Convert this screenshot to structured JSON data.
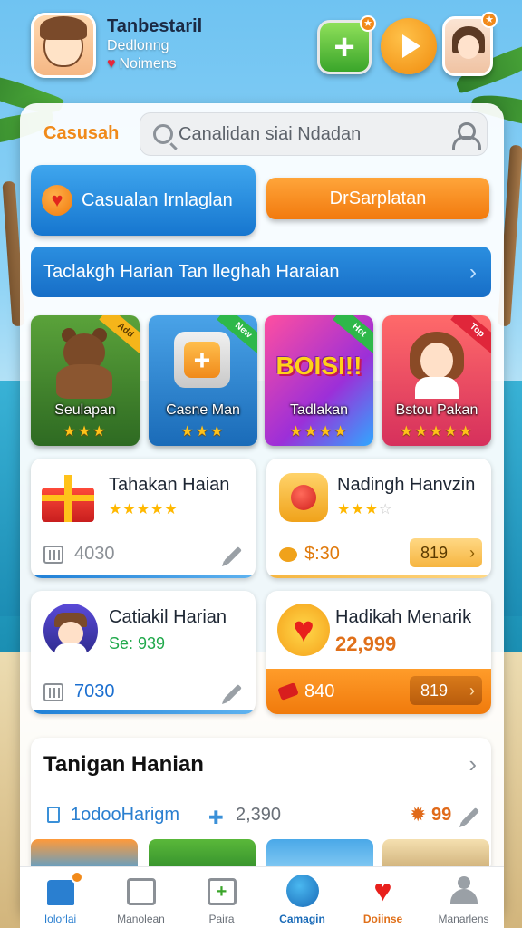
{
  "header": {
    "title": "Tanbestaril",
    "sub1": "Dedlonng",
    "sub2": "Noimens",
    "add_badge": "★",
    "friend_badge": "★"
  },
  "search": {
    "section_label": "Casusah",
    "placeholder": "Canalidan siai Ndadan"
  },
  "buttons": {
    "primary_label": "Casualan Irnlaglan",
    "orange_label": "DrSarplatan"
  },
  "banner": {
    "label": "Taclakgh Harian Tan lleghah Haraian"
  },
  "tiles": [
    {
      "label": "Seulapan",
      "stars": "★★★",
      "corner": "Add"
    },
    {
      "label": "Casne Man",
      "stars": "★★★",
      "corner": "New"
    },
    {
      "label": "Tadlakan",
      "stars": "★★★★",
      "corner": "Hot",
      "art_text": "BOISI!!"
    },
    {
      "label": "Bstou Pakan",
      "stars": "★★★★★",
      "corner": "Top"
    }
  ],
  "cards": [
    {
      "title": "Tahakan Haian",
      "stars_on": "★★★★★",
      "stars_off": "",
      "foot_value": "4030"
    },
    {
      "title": "Nadingh Hanvzin",
      "stars_on": "★★★",
      "stars_off": "☆",
      "foot_value": "$:30",
      "pill": "819"
    },
    {
      "title": "Catiakil Harian",
      "sub": "Se: 939",
      "foot_value": "7030"
    },
    {
      "title": "Hadikah Menarik",
      "sub": "22,999",
      "foot_value": "840",
      "pill": "819"
    }
  ],
  "section": {
    "title": "Tanigan Hanian",
    "stat1": "1odooHarigm",
    "stat2": "2,390",
    "stat3": "99"
  },
  "nav": [
    {
      "label": "Iolorlai",
      "icon": "home-icon"
    },
    {
      "label": "Manolean",
      "icon": "gallery-icon"
    },
    {
      "label": "Paira",
      "icon": "add-card-icon"
    },
    {
      "label": "Camagin",
      "icon": "wand-icon"
    },
    {
      "label": "Doiinse",
      "icon": "heart-icon"
    },
    {
      "label": "Manarlens",
      "icon": "profile-icon"
    }
  ],
  "colors": {
    "accent_blue": "#1676cf",
    "accent_orange": "#f27a0e",
    "star_gold": "#ffc21a"
  }
}
